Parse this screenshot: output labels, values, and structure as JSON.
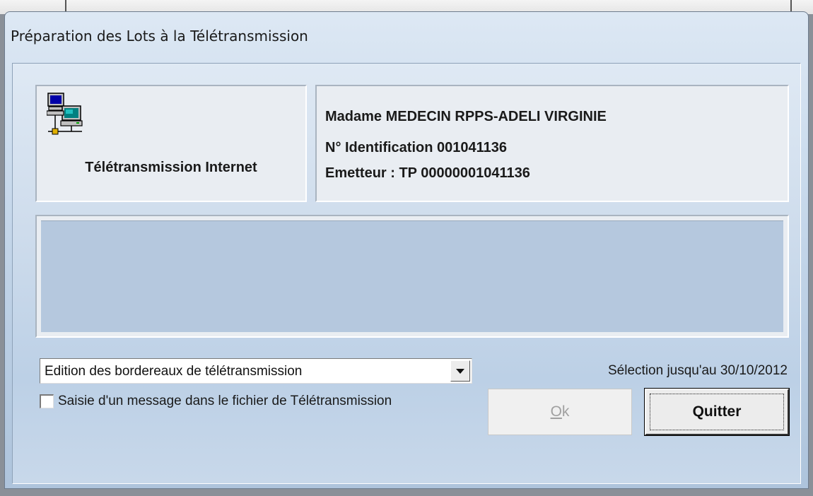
{
  "window": {
    "title": "Préparation des Lots à la Télétransmission"
  },
  "connection": {
    "icon": "network-computers-icon",
    "label": "Télétransmission Internet"
  },
  "practitioner": {
    "name": "Madame MEDECIN RPPS-ADELI VIRGINIE",
    "identification": "N° Identification 001041136",
    "emitter": "Emetteur : TP 00000001041136"
  },
  "message_area": {
    "text": ""
  },
  "options": {
    "dropdown_value": "Edition des bordereaux de télétransmission",
    "checkbox_label": "Saisie d'un message dans le fichier de Télétransmission",
    "checkbox_checked": false,
    "selection_text": "Sélection jusqu'au 30/10/2012"
  },
  "buttons": {
    "ok_mnemonic": "O",
    "ok_rest": "k",
    "ok_enabled": false,
    "quit_label": "Quitter"
  }
}
